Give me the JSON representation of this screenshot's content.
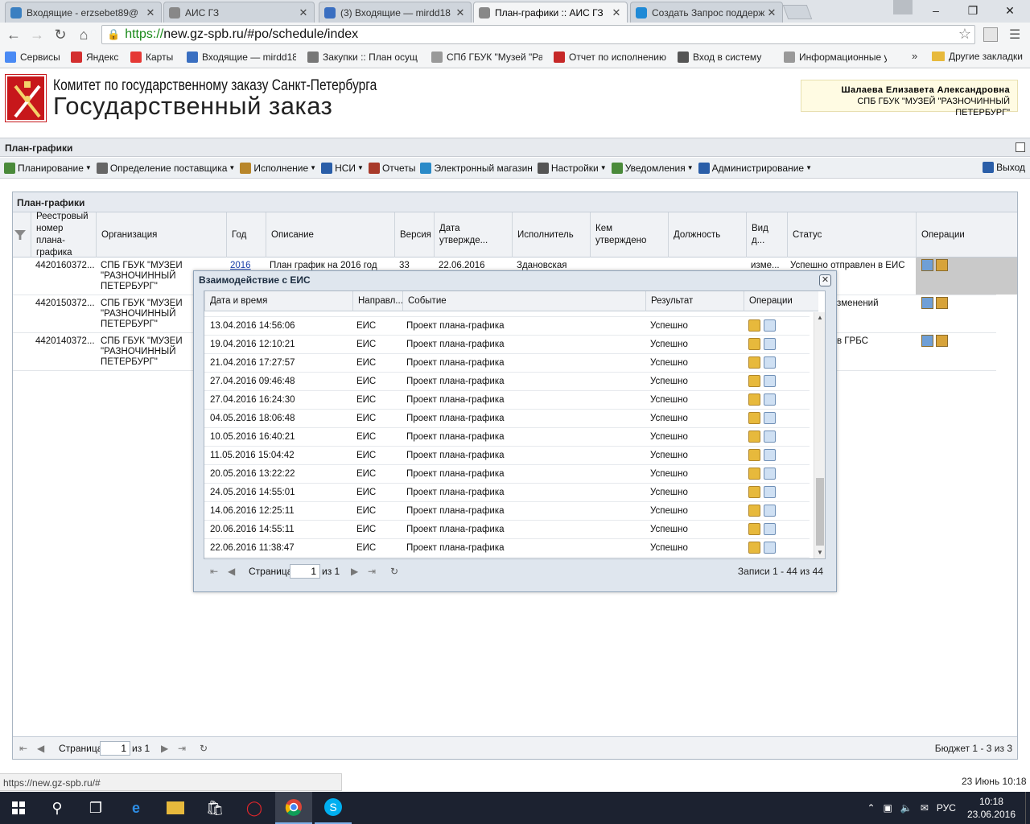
{
  "browser": {
    "tabs": [
      {
        "title": "Входящие - erzsebet89@",
        "icon_color": "#3a7fc1",
        "active": false
      },
      {
        "title": "АИС ГЗ",
        "icon_color": "#888888",
        "active": false
      },
      {
        "title": "(3) Входящие — mirdd18",
        "icon_color": "#3a6fc1",
        "active": false
      },
      {
        "title": "План-графики :: АИС ГЗ",
        "icon_color": "#888888",
        "active": true
      },
      {
        "title": "Создать Запрос поддерж",
        "icon_color": "#1f8ad6",
        "active": false
      }
    ],
    "url_scheme": "https://",
    "url_rest": "new.gz-spb.ru/#po/schedule/index",
    "bookmarks": [
      {
        "label": "Сервисы",
        "color": "#4a8af4"
      },
      {
        "label": "Яндекс",
        "color": "#d32f2f"
      },
      {
        "label": "Карты",
        "color": "#e53935"
      },
      {
        "label": "Входящие — mirdd18",
        "color": "#3a6fc1"
      },
      {
        "label": "Закупки :: План осущ",
        "color": "#777777"
      },
      {
        "label": "СПб ГБУК \"Музей \"Ра",
        "color": "#999999"
      },
      {
        "label": "Отчет по исполнению",
        "color": "#c62828"
      },
      {
        "label": "Вход в систему",
        "color": "#555555"
      },
      {
        "label": "Информационные ус",
        "color": "#999999"
      }
    ],
    "bookmarks_more": "»",
    "other_bookmarks": "Другие закладки",
    "status_url": "https://new.gz-spb.ru/#"
  },
  "header": {
    "line1": "Комитет по государственному заказу Санкт-Петербурга",
    "line2": "Государственный заказ",
    "user_name": "Шалаева Елизавета Александровна",
    "user_org": "СПБ ГБУК \"МУЗЕЙ \"РАЗНОЧИННЫЙ ПЕТЕРБУРГ\""
  },
  "section_title": "План-графики",
  "menu": [
    {
      "label": "Планирование",
      "dropdown": true,
      "color": "#4a8a3a"
    },
    {
      "label": "Определение поставщика",
      "dropdown": true,
      "color": "#666666"
    },
    {
      "label": "Исполнение",
      "dropdown": true,
      "color": "#b8862a"
    },
    {
      "label": "НСИ",
      "dropdown": true,
      "color": "#2a5ea8"
    },
    {
      "label": "Отчеты",
      "dropdown": false,
      "color": "#a83a2a"
    },
    {
      "label": "Электронный магазин",
      "dropdown": false,
      "color": "#2a8ac8"
    },
    {
      "label": "Настройки",
      "dropdown": true,
      "color": "#555555"
    },
    {
      "label": "Уведомления",
      "dropdown": true,
      "color": "#4a8a3a"
    },
    {
      "label": "Администрирование",
      "dropdown": true,
      "color": "#2a5ea8"
    }
  ],
  "exit_label": "Выход",
  "panel": {
    "title": "План-графики",
    "columns": [
      "Реестровый номер плана-графика",
      "Организация",
      "Год",
      "Описание",
      "Версия",
      "Дата утвержде...",
      "Исполнитель",
      "Кем утверждено",
      "Должность",
      "Вид д...",
      "Статус",
      "Операции"
    ],
    "rows": [
      {
        "reg": "4420160372...",
        "org": "СПБ ГБУК \"МУЗЕЙ \"РАЗНОЧИННЫЙ ПЕТЕРБУРГ\"",
        "year": "2016",
        "desc": "План график на 2016 год",
        "version": "33",
        "date": "22.06.2016",
        "exec": "Здановская",
        "kind": "изме...",
        "status": "Успешно отправлен в ЕИС"
      },
      {
        "reg": "4420150372...",
        "org": "СПБ ГБУК \"МУЗЕЙ \"РАЗНОЧИННЫЙ ПЕТЕРБУРГ\"",
        "status": "зменений"
      },
      {
        "reg": "4420140372...",
        "org": "СПБ ГБУК \"МУЗЕЙ \"РАЗНОЧИННЫЙ ПЕТЕРБУРГ\"",
        "status": "в ГРБС"
      }
    ],
    "pager": {
      "page_label": "Страница",
      "page": "1",
      "of": "из 1",
      "summary": "Бюджет 1 - 3 из 3"
    }
  },
  "modal": {
    "title": "Взаимодействие с ЕИС",
    "columns": [
      "Дата и время",
      "Направл...",
      "Событие",
      "Результат",
      "Операции"
    ],
    "rows": [
      {
        "dt": "13.04.2016 14:56:06",
        "dir": "ЕИС",
        "event": "Проект плана-графика",
        "result": "Успешно"
      },
      {
        "dt": "19.04.2016 12:10:21",
        "dir": "ЕИС",
        "event": "Проект плана-графика",
        "result": "Успешно"
      },
      {
        "dt": "21.04.2016 17:27:57",
        "dir": "ЕИС",
        "event": "Проект плана-графика",
        "result": "Успешно"
      },
      {
        "dt": "27.04.2016 09:46:48",
        "dir": "ЕИС",
        "event": "Проект плана-графика",
        "result": "Успешно"
      },
      {
        "dt": "27.04.2016 16:24:30",
        "dir": "ЕИС",
        "event": "Проект плана-графика",
        "result": "Успешно"
      },
      {
        "dt": "04.05.2016 18:06:48",
        "dir": "ЕИС",
        "event": "Проект плана-графика",
        "result": "Успешно"
      },
      {
        "dt": "10.05.2016 16:40:21",
        "dir": "ЕИС",
        "event": "Проект плана-графика",
        "result": "Успешно"
      },
      {
        "dt": "11.05.2016 15:04:42",
        "dir": "ЕИС",
        "event": "Проект плана-графика",
        "result": "Успешно"
      },
      {
        "dt": "20.05.2016 13:22:22",
        "dir": "ЕИС",
        "event": "Проект плана-графика",
        "result": "Успешно"
      },
      {
        "dt": "24.05.2016 14:55:01",
        "dir": "ЕИС",
        "event": "Проект плана-графика",
        "result": "Успешно"
      },
      {
        "dt": "14.06.2016 12:25:11",
        "dir": "ЕИС",
        "event": "Проект плана-графика",
        "result": "Успешно"
      },
      {
        "dt": "20.06.2016 14:55:11",
        "dir": "ЕИС",
        "event": "Проект плана-графика",
        "result": "Успешно"
      },
      {
        "dt": "22.06.2016 11:38:47",
        "dir": "ЕИС",
        "event": "Проект плана-графика",
        "result": "Успешно"
      }
    ],
    "pager": {
      "page_label": "Страница",
      "page": "1",
      "of": "из 1",
      "summary": "Записи 1 - 44 из 44"
    }
  },
  "bottom_date": "23 Июнь 10:18",
  "taskbar": {
    "lang": "РУС",
    "time": "10:18",
    "date": "23.06.2016"
  }
}
